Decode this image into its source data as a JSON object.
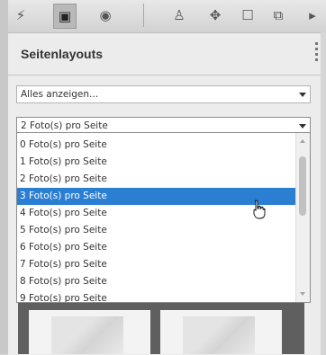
{
  "panel": {
    "title": "Seitenlayouts"
  },
  "filter_select": {
    "value": "Alles anzeigen..."
  },
  "layout_select": {
    "value": "2 Foto(s) pro Seite"
  },
  "layout_options": [
    "0 Foto(s) pro Seite",
    "1 Foto(s) pro Seite",
    "2 Foto(s) pro Seite",
    "3 Foto(s) pro Seite",
    "4 Foto(s) pro Seite",
    "5 Foto(s) pro Seite",
    "6 Foto(s) pro Seite",
    "7 Foto(s) pro Seite",
    "8 Foto(s) pro Seite",
    "9 Foto(s) pro Seite"
  ],
  "highlighted_option_index": 3,
  "colors": {
    "selection": "#2a7fd3"
  }
}
